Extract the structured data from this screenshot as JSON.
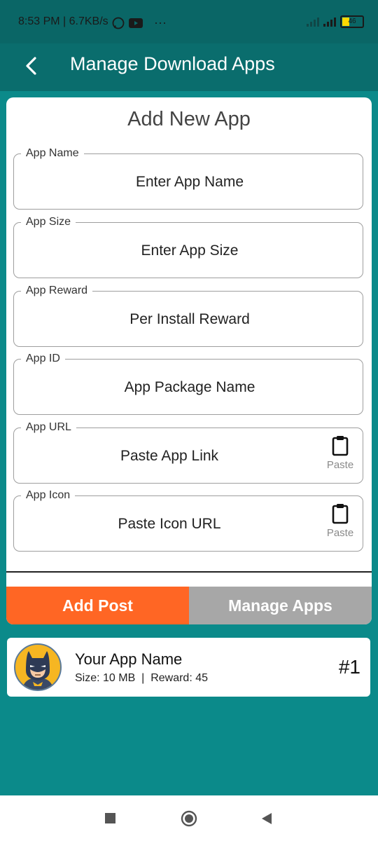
{
  "status": {
    "time": "8:53 PM | 6.7KB/s",
    "dots": "···",
    "battery": "46"
  },
  "appbar": {
    "title": "Manage Download Apps"
  },
  "form": {
    "title": "Add New App",
    "fields": [
      {
        "label": "App Name",
        "placeholder": "Enter App Name"
      },
      {
        "label": "App Size",
        "placeholder": "Enter App Size"
      },
      {
        "label": "App Reward",
        "placeholder": "Per Install Reward"
      },
      {
        "label": "App ID",
        "placeholder": "App Package Name"
      },
      {
        "label": "App URL",
        "placeholder": "Paste App Link",
        "paste_label": "Paste"
      },
      {
        "label": "App Icon",
        "placeholder": "Paste Icon URL",
        "paste_label": "Paste"
      }
    ]
  },
  "buttons": {
    "add_post": "Add Post",
    "manage_apps": "Manage Apps"
  },
  "app_item": {
    "name": "Your App Name",
    "meta": "Size: 10 MB  |  Reward: 45",
    "rank": "#1"
  },
  "colors": {
    "background": "#0B8A8A",
    "appbar": "#0A6D6D",
    "accent_orange": "#FF6624",
    "grey_button": "#A7A7A7"
  },
  "icons": [
    "back-arrow-icon",
    "clipboard-icon",
    "batman-avatar-icon",
    "whatsapp-icon",
    "youtube-icon"
  ]
}
